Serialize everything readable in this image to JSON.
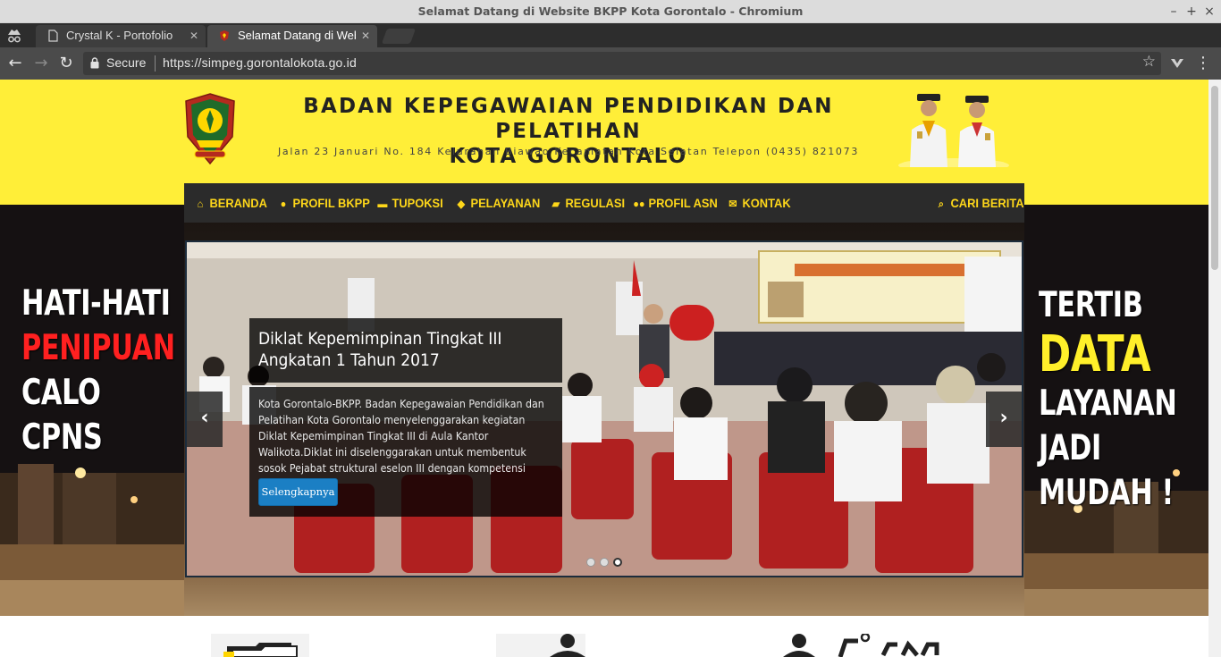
{
  "window": {
    "title": "Selamat Datang di Website BKPP Kota Gorontalo - Chromium",
    "controls": [
      "–",
      "+",
      "×"
    ]
  },
  "tabs": [
    {
      "label": "Crystal K - Portofolio",
      "close": "✕",
      "active": false
    },
    {
      "label": "Selamat Datang di Web",
      "close": "✕",
      "active": true
    }
  ],
  "toolbar": {
    "back": "←",
    "forward": "→",
    "reload": "↻",
    "secure_label": "Secure",
    "url": "https://simpeg.gorontalokota.go.id",
    "bookmark": "☆",
    "menu": "⋮"
  },
  "header": {
    "org_name_line1": "BADAN KEPEGAWAIAN PENDIDIKAN DAN PELATIHAN",
    "org_name_line2": "KOTA GORONTALO",
    "address": "Jalan 23 Januari No. 184 Kelurahan Biawao Kecamatan Kota Selatan Telepon (0435) 821073"
  },
  "nav": {
    "items": [
      {
        "label": "BERANDA",
        "icon": "home-icon",
        "glyph": "⌂"
      },
      {
        "label": "PROFIL BKPP",
        "icon": "user-icon",
        "glyph": "●"
      },
      {
        "label": "TUPOKSI",
        "icon": "briefcase-icon",
        "glyph": "▬"
      },
      {
        "label": "PELAYANAN",
        "icon": "tag-icon",
        "glyph": "◆"
      },
      {
        "label": "REGULASI",
        "icon": "book-icon",
        "glyph": "▰"
      },
      {
        "label": "PROFIL ASN",
        "icon": "users-icon",
        "glyph": "●●"
      },
      {
        "label": "KONTAK",
        "icon": "envelope-icon",
        "glyph": "✉"
      }
    ],
    "search": {
      "label": "CARI BERITA",
      "icon": "search-icon",
      "glyph": "⌕"
    }
  },
  "hero": {
    "left_slogan": {
      "line1": "HATI-HATI",
      "line2": "PENIPUAN",
      "line3": "CALO",
      "line4": "CPNS"
    },
    "right_slogan": {
      "line1": "TERTIB",
      "line2": "DATA",
      "line3": "LAYANAN",
      "line4": "JADI",
      "line5": "MUDAH !"
    }
  },
  "carousel": {
    "title": "Diklat Kepemimpinan Tingkat III Angkatan 1 Tahun 2017",
    "body": "Kota Gorontalo-BKPP. Badan Kepegawaian Pendidikan dan Pelatihan Kota Gorontalo menyelenggarakan kegiatan Diklat Kepemimpinan Tingkat III di Aula Kantor Walikota.Diklat ini diselenggarakan untuk membentuk sosok Pejabat struktural eselon III dengan kompetensi pemi...",
    "button": "Selengkapnya",
    "prev": "‹",
    "next": "›",
    "slide_count": 3,
    "active_slide": 3
  },
  "colors": {
    "header_bg": "#ffee38",
    "nav_bg": "#2b2b2b",
    "nav_text": "#fed71a",
    "button_blue": "#1b7fc4",
    "slogan_red": "#ff2020",
    "slogan_yellow": "#ffef2a"
  }
}
